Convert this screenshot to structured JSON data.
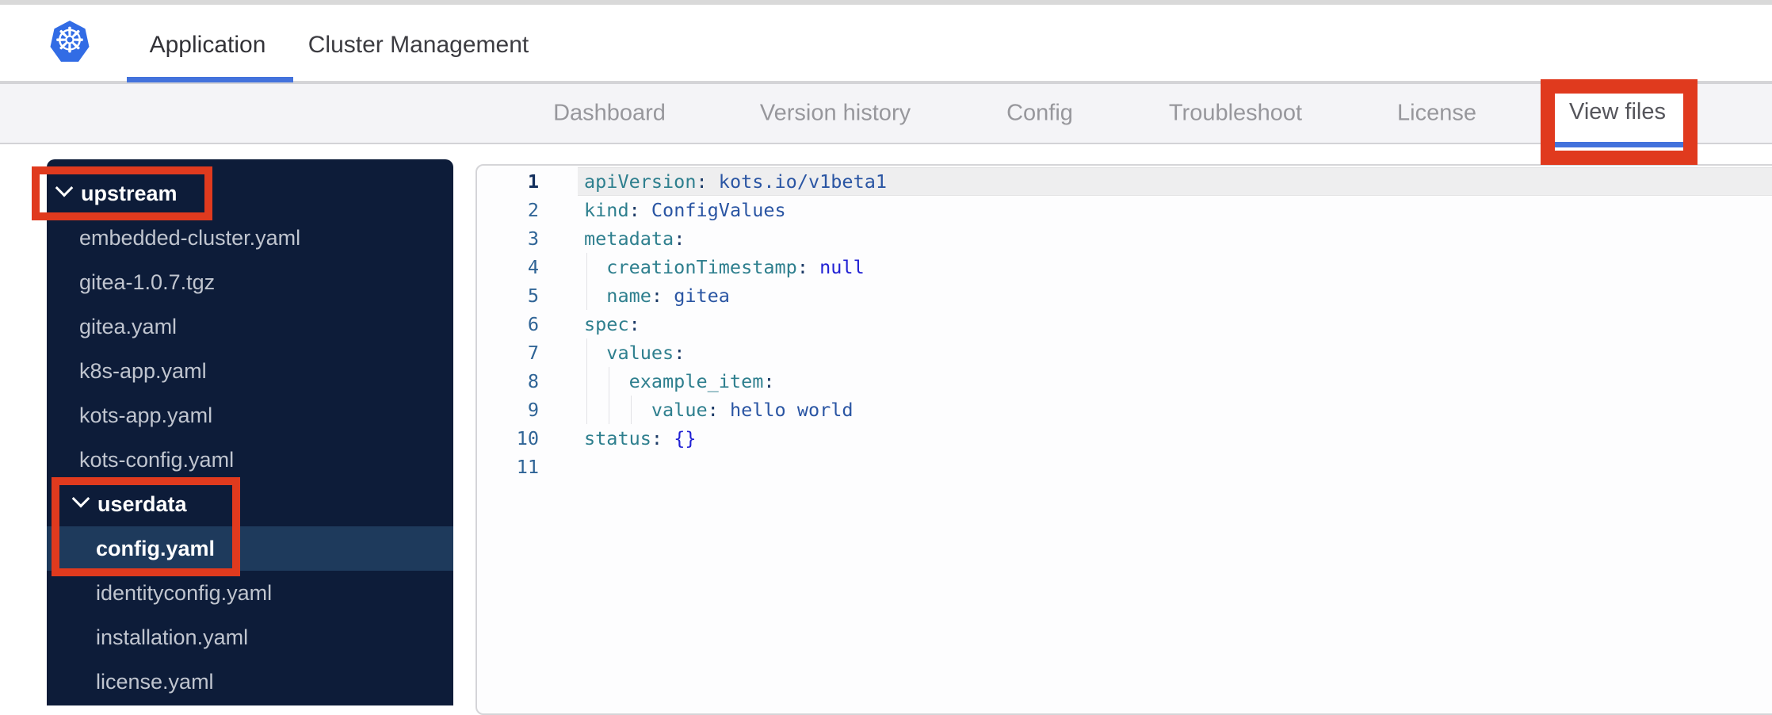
{
  "header": {
    "logo": "kubernetes-logo",
    "logo_glyph": "☸",
    "tabs": [
      {
        "label": "Application",
        "active": true
      },
      {
        "label": "Cluster Management",
        "active": false
      }
    ]
  },
  "subnav": {
    "tabs": [
      {
        "label": "Dashboard",
        "active": false
      },
      {
        "label": "Version history",
        "active": false
      },
      {
        "label": "Config",
        "active": false
      },
      {
        "label": "Troubleshoot",
        "active": false
      },
      {
        "label": "License",
        "active": false
      },
      {
        "label": "View files",
        "active": true
      }
    ]
  },
  "file_tree": {
    "items": [
      {
        "label": "upstream",
        "type": "folder",
        "level": 0,
        "expanded": true,
        "annotated": true
      },
      {
        "label": "embedded-cluster.yaml",
        "type": "file",
        "level": 0
      },
      {
        "label": "gitea-1.0.7.tgz",
        "type": "file",
        "level": 0
      },
      {
        "label": "gitea.yaml",
        "type": "file",
        "level": 0
      },
      {
        "label": "k8s-app.yaml",
        "type": "file",
        "level": 0
      },
      {
        "label": "kots-app.yaml",
        "type": "file",
        "level": 0
      },
      {
        "label": "kots-config.yaml",
        "type": "file",
        "level": 0
      },
      {
        "label": "userdata",
        "type": "folder",
        "level": 1,
        "expanded": true,
        "annotated": true
      },
      {
        "label": "config.yaml",
        "type": "file",
        "level": 1,
        "selected": true,
        "annotated": true
      },
      {
        "label": "identityconfig.yaml",
        "type": "file",
        "level": 1
      },
      {
        "label": "installation.yaml",
        "type": "file",
        "level": 1
      },
      {
        "label": "license.yaml",
        "type": "file",
        "level": 1
      }
    ]
  },
  "editor": {
    "language": "yaml",
    "lines": [
      {
        "num": 1,
        "guides": 0,
        "active": true,
        "tokens": [
          [
            "k",
            "apiVersion"
          ],
          [
            "p",
            ":"
          ],
          [
            "t",
            " "
          ],
          [
            "v",
            "kots.io/v1beta1"
          ]
        ]
      },
      {
        "num": 2,
        "guides": 0,
        "tokens": [
          [
            "k",
            "kind"
          ],
          [
            "p",
            ":"
          ],
          [
            "t",
            " "
          ],
          [
            "v",
            "ConfigValues"
          ]
        ]
      },
      {
        "num": 3,
        "guides": 0,
        "tokens": [
          [
            "k",
            "metadata"
          ],
          [
            "p",
            ":"
          ]
        ]
      },
      {
        "num": 4,
        "guides": 1,
        "tokens": [
          [
            "t",
            "  "
          ],
          [
            "k",
            "creationTimestamp"
          ],
          [
            "p",
            ":"
          ],
          [
            "t",
            " "
          ],
          [
            "l",
            "null"
          ]
        ]
      },
      {
        "num": 5,
        "guides": 1,
        "tokens": [
          [
            "t",
            "  "
          ],
          [
            "k",
            "name"
          ],
          [
            "p",
            ":"
          ],
          [
            "t",
            " "
          ],
          [
            "v",
            "gitea"
          ]
        ]
      },
      {
        "num": 6,
        "guides": 0,
        "tokens": [
          [
            "k",
            "spec"
          ],
          [
            "p",
            ":"
          ]
        ]
      },
      {
        "num": 7,
        "guides": 1,
        "tokens": [
          [
            "t",
            "  "
          ],
          [
            "k",
            "values"
          ],
          [
            "p",
            ":"
          ]
        ]
      },
      {
        "num": 8,
        "guides": 2,
        "tokens": [
          [
            "t",
            "    "
          ],
          [
            "k",
            "example_item"
          ],
          [
            "p",
            ":"
          ]
        ]
      },
      {
        "num": 9,
        "guides": 3,
        "tokens": [
          [
            "t",
            "      "
          ],
          [
            "k",
            "value"
          ],
          [
            "p",
            ":"
          ],
          [
            "t",
            " "
          ],
          [
            "v",
            "hello world"
          ]
        ]
      },
      {
        "num": 10,
        "guides": 0,
        "tokens": [
          [
            "k",
            "status"
          ],
          [
            "p",
            ":"
          ],
          [
            "t",
            " "
          ],
          [
            "l",
            "{}"
          ]
        ]
      },
      {
        "num": 11,
        "guides": 0,
        "tokens": []
      }
    ]
  },
  "annotations": {
    "color": "#e03a1e",
    "boxes": [
      "view-files-tab",
      "upstream-folder",
      "userdata-and-config"
    ]
  }
}
